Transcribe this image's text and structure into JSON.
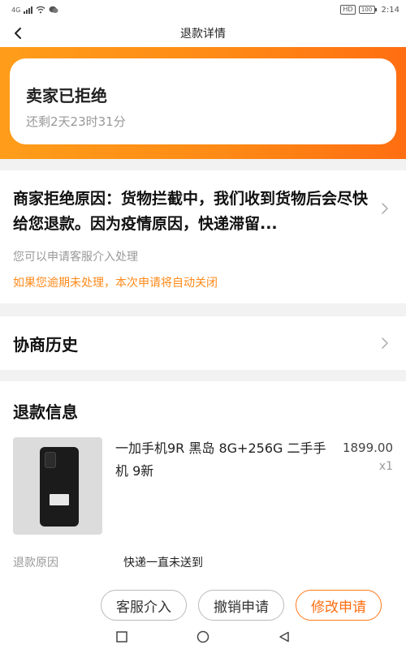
{
  "status_bar": {
    "network": "4G",
    "time": "2:14",
    "hd": "HD",
    "battery": "100"
  },
  "nav": {
    "title": "退款详情",
    "back_icon": "chevron-left-icon"
  },
  "status_card": {
    "title": "卖家已拒绝",
    "countdown": "还剩2天23时31分"
  },
  "reason": {
    "text": "商家拒绝原因：货物拦截中，我们收到货物后会尽快给您退款。因为疫情原因，快递滞留...",
    "hint_service": "您可以申请客服介入处理",
    "hint_auto_close": "如果您逾期未处理，本次申请将自动关闭"
  },
  "history": {
    "title": "协商历史"
  },
  "refund_info": {
    "title": "退款信息",
    "product": {
      "name": "一加手机9R 黑岛 8G+256G 二手手机 9新",
      "price": "1899.00",
      "quantity": "x1"
    },
    "reason_label": "退款原因",
    "reason_value": "快递一直未送到"
  },
  "actions": {
    "service": "客服介入",
    "cancel": "撤销申请",
    "modify": "修改申请"
  },
  "colors": {
    "accent": "#ff7a1a",
    "warning_text": "#ff8a1a"
  }
}
